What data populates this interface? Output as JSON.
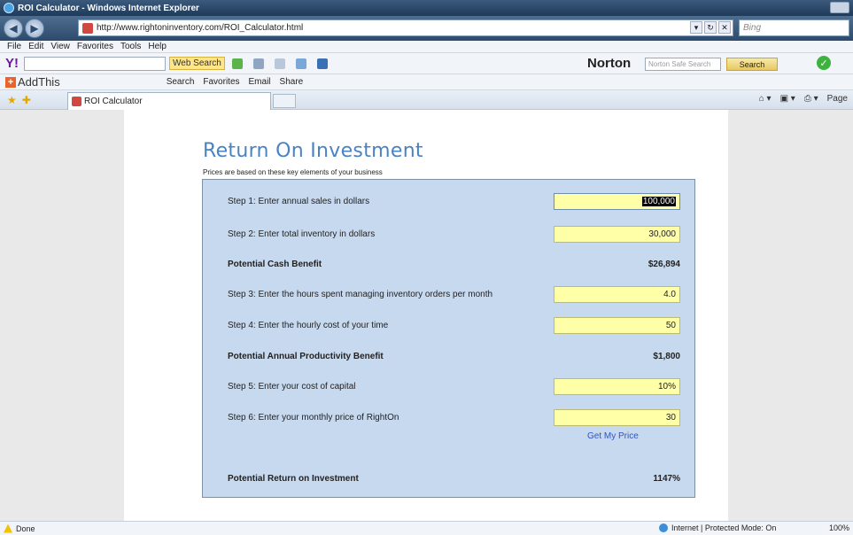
{
  "window": {
    "title": "ROI Calculator - Windows Internet Explorer"
  },
  "address": {
    "url": "http://www.rightoninventory.com/ROI_Calculator.html",
    "search_placeholder": "Bing"
  },
  "menu": [
    "File",
    "Edit",
    "View",
    "Favorites",
    "Tools",
    "Help"
  ],
  "toolbar1": {
    "yahoo_logo": "Y!",
    "web_search_label": "Web Search",
    "norton_label": "Norton",
    "norton_search_placeholder": "Norton Safe Search",
    "norton_search_button": "Search"
  },
  "toolbar2": {
    "addthis_label": "AddThis",
    "search_label": "Search",
    "favorites_label": "Favorites",
    "email_label": "Email",
    "share_label": "Share"
  },
  "tab": {
    "label": "ROI Calculator",
    "page_label": "Page"
  },
  "page": {
    "title": "Return On Investment",
    "subtitle": "Prices are based on these key elements of your business"
  },
  "calculator": {
    "rows": [
      {
        "label": "Step 1: Enter annual sales in dollars",
        "value": "100,000"
      },
      {
        "label": "Step 2: Enter total inventory in dollars",
        "value": "30,000"
      },
      {
        "label": "Potential Cash Benefit",
        "result": "$26,894"
      },
      {
        "label": "Step 3: Enter the hours spent managing inventory orders per month",
        "value": "4.0"
      },
      {
        "label": "Step 4: Enter the hourly cost of your time",
        "value": "50"
      },
      {
        "label": "Potential Annual Productivity Benefit",
        "result": "$1,800"
      },
      {
        "label": "Step 5: Enter your cost of capital",
        "value": "10%"
      },
      {
        "label": "Step 6: Enter your monthly price of RightOn",
        "value": "30"
      },
      {
        "label": "Potential Return on Investment",
        "result": "1147%"
      }
    ],
    "get_price_label": "Get My Price"
  },
  "status": {
    "left": "Done",
    "zone": "Internet | Protected Mode: On",
    "zoom": "100%"
  }
}
